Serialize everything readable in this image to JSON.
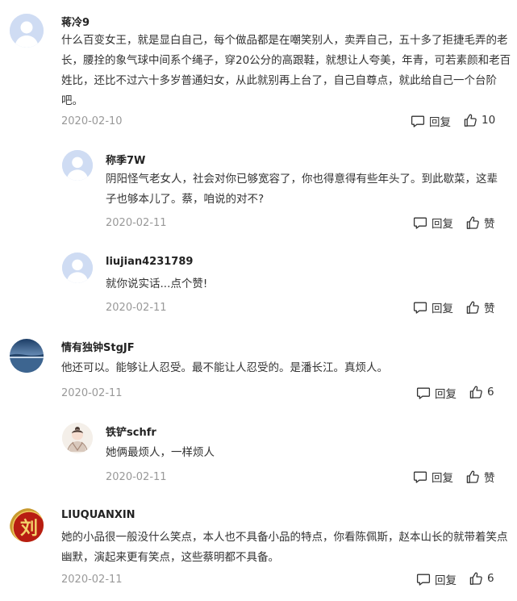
{
  "comments": [
    {
      "user": "蒋冷9",
      "text": "什么百变女王，就是显白自己，每个做品都是在嘲笑别人，卖弄自己，五十多了拒捷毛弄的老长，腰拴的象气球中间系个绳子，穿20公分的高跟鞋，就想让人夸美，年青，可若素颜和老百姓比，还比不过六十多岁普通妇女，从此就别再上台了，自己自尊点，就此给自己一个台阶吧。",
      "date": "2020-02-10",
      "reply_label": "回复",
      "like_label": "10",
      "avatar": "default-avatar-icon"
    },
    {
      "user": "称季7W",
      "text": "阴阳怪气老女人，社会对你已够宽容了，你也得意得有些年头了。到此歇菜，这辈子也够本儿了。蔡，咱说的对不?",
      "date": "2020-02-11",
      "reply_label": "回复",
      "like_label": "赞",
      "avatar": "default-avatar-icon"
    },
    {
      "user": "liujian4231789",
      "text": "就你说实话...点个赞!",
      "date": "2020-02-11",
      "reply_label": "回复",
      "like_label": "赞",
      "avatar": "default-avatar-icon"
    },
    {
      "user": "情有独钟StgJF",
      "text": "他还可以。能够让人忍受。最不能让人忍受的。是潘长江。真烦人。",
      "date": "2020-02-11",
      "reply_label": "回复",
      "like_label": "6",
      "avatar": "lake-photo-avatar"
    },
    {
      "user": "铁铲schfr",
      "text": "她俩最烦人，一样烦人",
      "date": "2020-02-11",
      "reply_label": "回复",
      "like_label": "赞",
      "avatar": "cartoon-figure-avatar"
    },
    {
      "user": "LIUQUANXIN",
      "text": "她的小品很一般没什么笑点，本人也不具备小品的特点，你看陈佩斯，赵本山长的就带着笑点幽默，演起来更有笑点，这些蔡明都不具备。",
      "date": "2020-02-11",
      "reply_label": "回复",
      "like_label": "6",
      "avatar": "liu-seal-avatar",
      "avatar_char": "刘"
    }
  ],
  "colors": {
    "text": "#333333",
    "meta": "#999999",
    "default_avatar": "#cfdcf3"
  }
}
